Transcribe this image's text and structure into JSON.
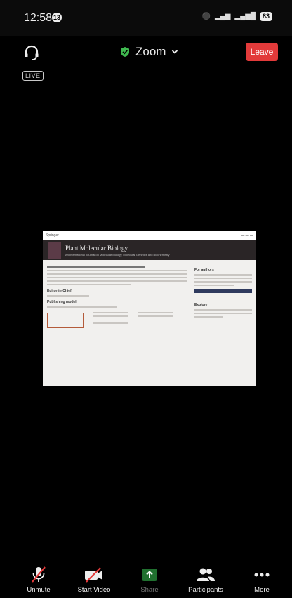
{
  "status_bar": {
    "time": "12:58",
    "notification_count": "13",
    "battery": "83"
  },
  "top_bar": {
    "meeting_title": "Zoom",
    "leave_label": "Leave",
    "live_badge": "LIVE"
  },
  "shared_screen": {
    "site_label": "Springer",
    "journal_title": "Plant Molecular Biology",
    "journal_subtitle": "An International Journal on Molecular Biology, Molecular Genetics and Biochemistry",
    "editor_heading": "Editor-in-Chief",
    "publishing_heading": "Publishing model",
    "authors_heading": "For authors",
    "explore_heading": "Explore"
  },
  "bottom_bar": {
    "items": [
      {
        "label": "Unmute"
      },
      {
        "label": "Start Video"
      },
      {
        "label": "Share"
      },
      {
        "label": "Participants"
      },
      {
        "label": "More"
      }
    ]
  },
  "colors": {
    "leave": "#e23a3a",
    "share_green": "#2ea043",
    "secure_green": "#3fb950"
  }
}
